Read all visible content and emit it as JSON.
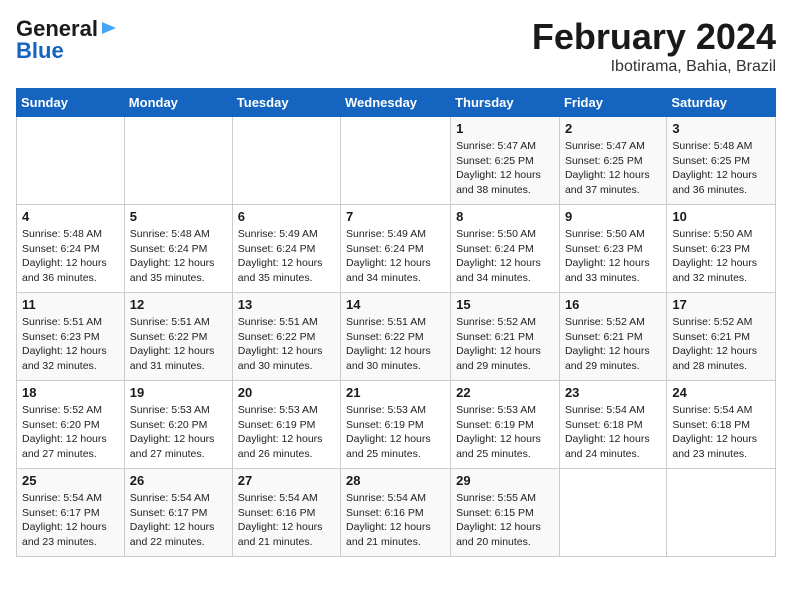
{
  "header": {
    "logo_general": "General",
    "logo_blue": "Blue",
    "month_year": "February 2024",
    "location": "Ibotirama, Bahia, Brazil"
  },
  "days_of_week": [
    "Sunday",
    "Monday",
    "Tuesday",
    "Wednesday",
    "Thursday",
    "Friday",
    "Saturday"
  ],
  "weeks": [
    [
      {
        "num": "",
        "info": ""
      },
      {
        "num": "",
        "info": ""
      },
      {
        "num": "",
        "info": ""
      },
      {
        "num": "",
        "info": ""
      },
      {
        "num": "1",
        "info": "Sunrise: 5:47 AM\nSunset: 6:25 PM\nDaylight: 12 hours\nand 38 minutes."
      },
      {
        "num": "2",
        "info": "Sunrise: 5:47 AM\nSunset: 6:25 PM\nDaylight: 12 hours\nand 37 minutes."
      },
      {
        "num": "3",
        "info": "Sunrise: 5:48 AM\nSunset: 6:25 PM\nDaylight: 12 hours\nand 36 minutes."
      }
    ],
    [
      {
        "num": "4",
        "info": "Sunrise: 5:48 AM\nSunset: 6:24 PM\nDaylight: 12 hours\nand 36 minutes."
      },
      {
        "num": "5",
        "info": "Sunrise: 5:48 AM\nSunset: 6:24 PM\nDaylight: 12 hours\nand 35 minutes."
      },
      {
        "num": "6",
        "info": "Sunrise: 5:49 AM\nSunset: 6:24 PM\nDaylight: 12 hours\nand 35 minutes."
      },
      {
        "num": "7",
        "info": "Sunrise: 5:49 AM\nSunset: 6:24 PM\nDaylight: 12 hours\nand 34 minutes."
      },
      {
        "num": "8",
        "info": "Sunrise: 5:50 AM\nSunset: 6:24 PM\nDaylight: 12 hours\nand 34 minutes."
      },
      {
        "num": "9",
        "info": "Sunrise: 5:50 AM\nSunset: 6:23 PM\nDaylight: 12 hours\nand 33 minutes."
      },
      {
        "num": "10",
        "info": "Sunrise: 5:50 AM\nSunset: 6:23 PM\nDaylight: 12 hours\nand 32 minutes."
      }
    ],
    [
      {
        "num": "11",
        "info": "Sunrise: 5:51 AM\nSunset: 6:23 PM\nDaylight: 12 hours\nand 32 minutes."
      },
      {
        "num": "12",
        "info": "Sunrise: 5:51 AM\nSunset: 6:22 PM\nDaylight: 12 hours\nand 31 minutes."
      },
      {
        "num": "13",
        "info": "Sunrise: 5:51 AM\nSunset: 6:22 PM\nDaylight: 12 hours\nand 30 minutes."
      },
      {
        "num": "14",
        "info": "Sunrise: 5:51 AM\nSunset: 6:22 PM\nDaylight: 12 hours\nand 30 minutes."
      },
      {
        "num": "15",
        "info": "Sunrise: 5:52 AM\nSunset: 6:21 PM\nDaylight: 12 hours\nand 29 minutes."
      },
      {
        "num": "16",
        "info": "Sunrise: 5:52 AM\nSunset: 6:21 PM\nDaylight: 12 hours\nand 29 minutes."
      },
      {
        "num": "17",
        "info": "Sunrise: 5:52 AM\nSunset: 6:21 PM\nDaylight: 12 hours\nand 28 minutes."
      }
    ],
    [
      {
        "num": "18",
        "info": "Sunrise: 5:52 AM\nSunset: 6:20 PM\nDaylight: 12 hours\nand 27 minutes."
      },
      {
        "num": "19",
        "info": "Sunrise: 5:53 AM\nSunset: 6:20 PM\nDaylight: 12 hours\nand 27 minutes."
      },
      {
        "num": "20",
        "info": "Sunrise: 5:53 AM\nSunset: 6:19 PM\nDaylight: 12 hours\nand 26 minutes."
      },
      {
        "num": "21",
        "info": "Sunrise: 5:53 AM\nSunset: 6:19 PM\nDaylight: 12 hours\nand 25 minutes."
      },
      {
        "num": "22",
        "info": "Sunrise: 5:53 AM\nSunset: 6:19 PM\nDaylight: 12 hours\nand 25 minutes."
      },
      {
        "num": "23",
        "info": "Sunrise: 5:54 AM\nSunset: 6:18 PM\nDaylight: 12 hours\nand 24 minutes."
      },
      {
        "num": "24",
        "info": "Sunrise: 5:54 AM\nSunset: 6:18 PM\nDaylight: 12 hours\nand 23 minutes."
      }
    ],
    [
      {
        "num": "25",
        "info": "Sunrise: 5:54 AM\nSunset: 6:17 PM\nDaylight: 12 hours\nand 23 minutes."
      },
      {
        "num": "26",
        "info": "Sunrise: 5:54 AM\nSunset: 6:17 PM\nDaylight: 12 hours\nand 22 minutes."
      },
      {
        "num": "27",
        "info": "Sunrise: 5:54 AM\nSunset: 6:16 PM\nDaylight: 12 hours\nand 21 minutes."
      },
      {
        "num": "28",
        "info": "Sunrise: 5:54 AM\nSunset: 6:16 PM\nDaylight: 12 hours\nand 21 minutes."
      },
      {
        "num": "29",
        "info": "Sunrise: 5:55 AM\nSunset: 6:15 PM\nDaylight: 12 hours\nand 20 minutes."
      },
      {
        "num": "",
        "info": ""
      },
      {
        "num": "",
        "info": ""
      }
    ]
  ]
}
